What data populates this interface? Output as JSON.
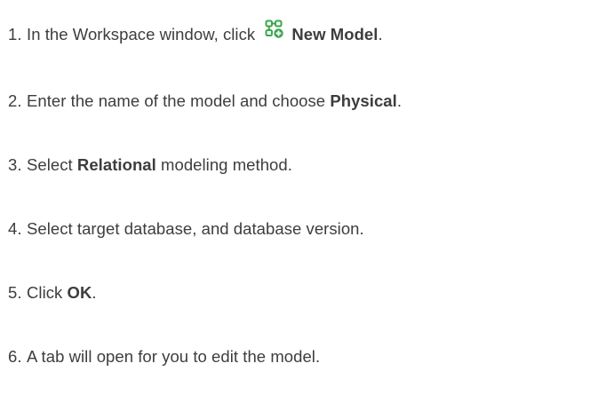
{
  "steps": [
    {
      "number": "1.",
      "pre": "In the Workspace window, click ",
      "icon": "new-model-icon",
      "bold": "New Model",
      "post": "."
    },
    {
      "number": "2.",
      "pre": "Enter the name of the model and choose ",
      "bold": "Physical",
      "post": "."
    },
    {
      "number": "3.",
      "pre": "Select ",
      "bold": "Relational",
      "post": " modeling method."
    },
    {
      "number": "4.",
      "pre": "Select target database, and database version.",
      "bold": "",
      "post": ""
    },
    {
      "number": "5.",
      "pre": "Click ",
      "bold": "OK",
      "post": "."
    },
    {
      "number": "6.",
      "pre": "A tab will open for you to edit the model.",
      "bold": "",
      "post": ""
    }
  ],
  "colors": {
    "text": "#3d3d3d",
    "icon_green": "#3aa64b"
  }
}
